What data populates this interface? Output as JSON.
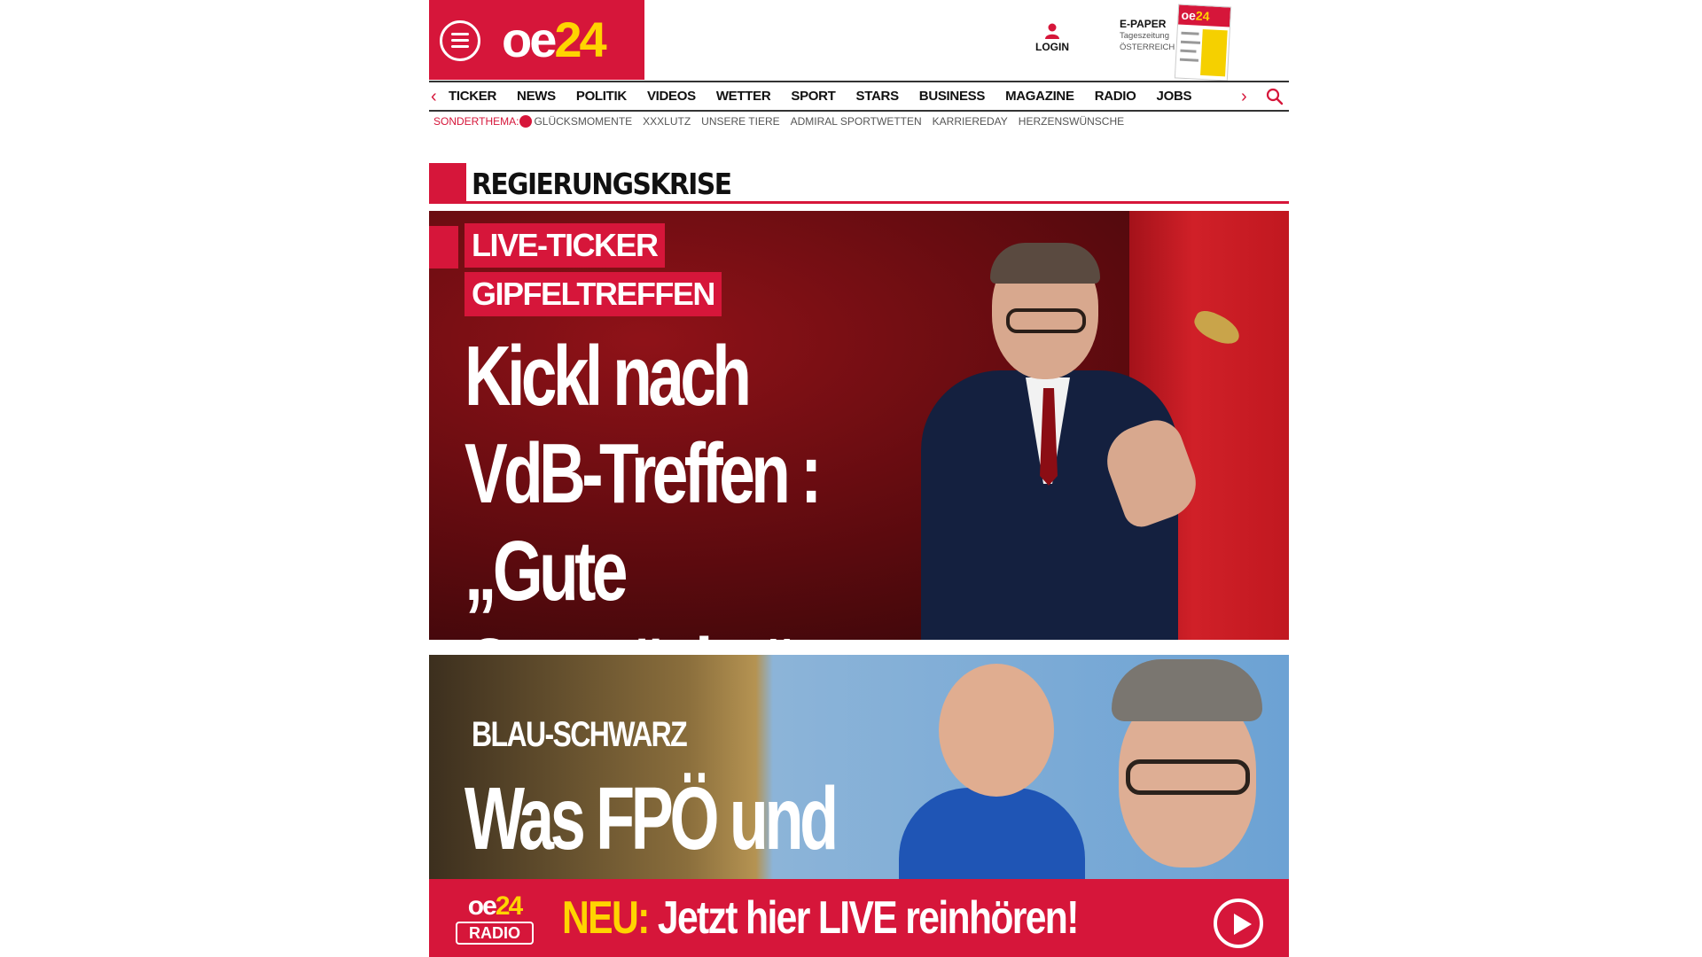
{
  "brand": {
    "logo_main": "oe",
    "logo_num": "24",
    "color_primary": "#d6163a",
    "color_accent": "#ffd400"
  },
  "header": {
    "login_label": "LOGIN",
    "epaper": {
      "title": "E-PAPER",
      "subtitle1": "Tageszeitung",
      "subtitle2": "ÖSTERREICH"
    }
  },
  "nav": {
    "items": [
      "TICKER",
      "NEWS",
      "POLITIK",
      "VIDEOS",
      "WETTER",
      "SPORT",
      "STARS",
      "BUSINESS",
      "MAGAZINE",
      "RADIO",
      "JOBS"
    ],
    "prev_icon": "chevron-left-icon",
    "next_icon": "chevron-right-icon",
    "search_icon": "search-icon"
  },
  "subnav": {
    "label": "SONDERTHEMA:",
    "items": [
      "GLÜCKSMOMENTE",
      "XXXLUTZ",
      "UNSERE TIERE",
      "ADMIRAL SPORTWETTEN",
      "KARRIEREDAY",
      "HERZENSWÜNSCHE"
    ]
  },
  "section": {
    "title": "REGIERUNGSKRISE"
  },
  "hero": {
    "tag1": "LIVE-TICKER",
    "tag2": "GIPFELTREFFEN",
    "headline_line1": "Kickl nach",
    "headline_line2": "VdB-Treffen :",
    "headline_line3": "„Gute Gespräche“"
  },
  "article2": {
    "tag": "BLAU-SCHWARZ",
    "headline": "Was FPÖ und"
  },
  "radio_banner": {
    "logo_main": "oe",
    "logo_num": "24",
    "logo_label": "RADIO",
    "new_label": "NEU:",
    "text": "Jetzt hier LIVE reinhören!",
    "play_icon": "play-icon"
  }
}
